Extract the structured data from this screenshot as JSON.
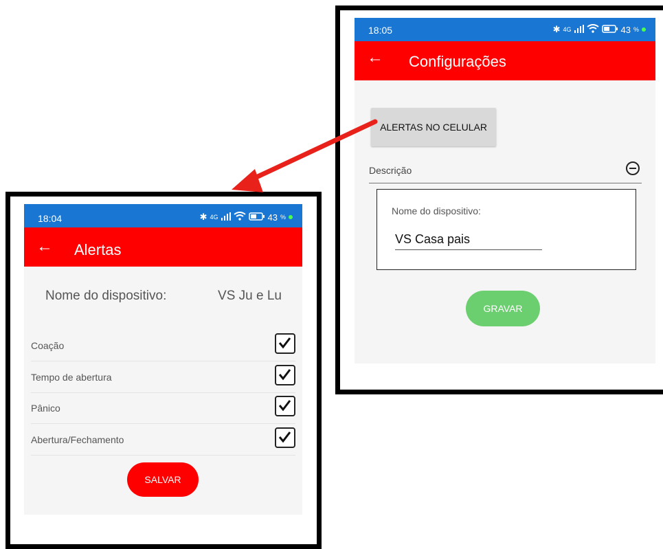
{
  "alerts_screen": {
    "status": {
      "time": "18:04",
      "network": "4G",
      "battery": "43"
    },
    "appbar": {
      "title": "Alertas"
    },
    "device": {
      "label": "Nome do dispositivo:",
      "value": "VS Ju e Lu"
    },
    "alerts": [
      {
        "label": "Coação",
        "checked": true
      },
      {
        "label": "Tempo de abertura",
        "checked": true
      },
      {
        "label": "Pânico",
        "checked": true
      },
      {
        "label": "Abertura/Fechamento",
        "checked": true
      }
    ],
    "save_label": "SALVAR"
  },
  "settings_screen": {
    "status": {
      "time": "18:05",
      "network": "4G",
      "battery": "43"
    },
    "appbar": {
      "title": "Configurações"
    },
    "alerts_button_label": "ALERTAS NO CELULAR",
    "description_label": "Descrição",
    "device_field": {
      "label": "Nome do dispositivo:",
      "value": "VS Casa pais"
    },
    "record_label": "GRAVAR"
  },
  "colors": {
    "statusbar": "#1976d2",
    "appbar": "#ff0000",
    "save_button": "#ff0000",
    "record_button": "#6ccf6f",
    "arrow": "#e8221b"
  }
}
